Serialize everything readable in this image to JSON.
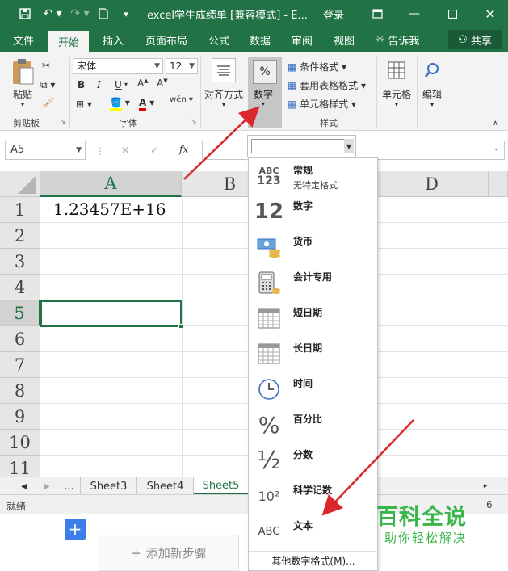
{
  "titlebar": {
    "title": "excel学生成绩单 [兼容模式] - E...",
    "login": "登录",
    "save_icon": "save-icon",
    "undo_icon": "undo-icon",
    "redo_icon": "redo-icon"
  },
  "tabs": [
    {
      "label": "文件"
    },
    {
      "label": "开始"
    },
    {
      "label": "插入"
    },
    {
      "label": "页面布局"
    },
    {
      "label": "公式"
    },
    {
      "label": "数据"
    },
    {
      "label": "审阅"
    },
    {
      "label": "视图"
    },
    {
      "label": "告诉我"
    }
  ],
  "share_label": "共享",
  "ribbon": {
    "paste_label": "粘贴",
    "clipboard_label": "剪贴板",
    "font_name": "宋体",
    "font_size": "12",
    "font_group_label": "字体",
    "bold": "B",
    "italic": "I",
    "underline": "U",
    "font_color_letter": "A",
    "wen_label": "wén",
    "align_label": "对齐方式",
    "number_label": "数字",
    "percent_glyph": "%",
    "cond_format_label": "条件格式",
    "table_format_label": "套用表格格式",
    "cell_style_label": "单元格样式",
    "styles_group_label": "样式",
    "cells_label": "单元格",
    "edit_label": "编辑"
  },
  "formula_bar": {
    "name_box": "A5",
    "fx": "fx",
    "cancel": "✕",
    "confirm": "✓"
  },
  "grid": {
    "columns": [
      "A",
      "B",
      "C",
      "D"
    ],
    "rows": [
      "1",
      "2",
      "3",
      "4",
      "5",
      "6",
      "7",
      "8",
      "9",
      "10",
      "11"
    ],
    "cell_a1": "1.23457E+16",
    "selected_cell": "A5"
  },
  "sheets": {
    "ellipsis": "...",
    "tabs": [
      "Sheet3",
      "Sheet4",
      "Sheet5"
    ],
    "active": "Sheet5"
  },
  "status": {
    "ready": "就绪",
    "right_num": "6"
  },
  "below": {
    "add_step": "添加新步骤",
    "plus": "+"
  },
  "number_formats": [
    {
      "label": "常规",
      "sub": "无特定格式",
      "icon": "general-abc123-icon"
    },
    {
      "label": "数字",
      "icon": "number-12-icon"
    },
    {
      "label": "货币",
      "icon": "currency-icon"
    },
    {
      "label": "会计专用",
      "icon": "accounting-icon"
    },
    {
      "label": "短日期",
      "icon": "short-date-icon"
    },
    {
      "label": "长日期",
      "icon": "long-date-icon"
    },
    {
      "label": "时间",
      "icon": "clock-icon"
    },
    {
      "label": "百分比",
      "icon": "percent-icon"
    },
    {
      "label": "分数",
      "icon": "fraction-icon"
    },
    {
      "label": "科学记数",
      "icon": "scientific-icon"
    },
    {
      "label": "文本",
      "icon": "text-abc-icon"
    }
  ],
  "icon_text": {
    "abc": "ABC",
    "n123": "123",
    "twelve": "12",
    "percent": "%",
    "half": "½",
    "sci": "10²"
  },
  "more_formats": "其他数字格式(M)...",
  "watermark": {
    "title": "百科全说",
    "subtitle": "助你轻松解决"
  },
  "colors": {
    "excel_green": "#217346",
    "arrow_red": "#d9272e",
    "watermark_green": "#39b54a"
  }
}
